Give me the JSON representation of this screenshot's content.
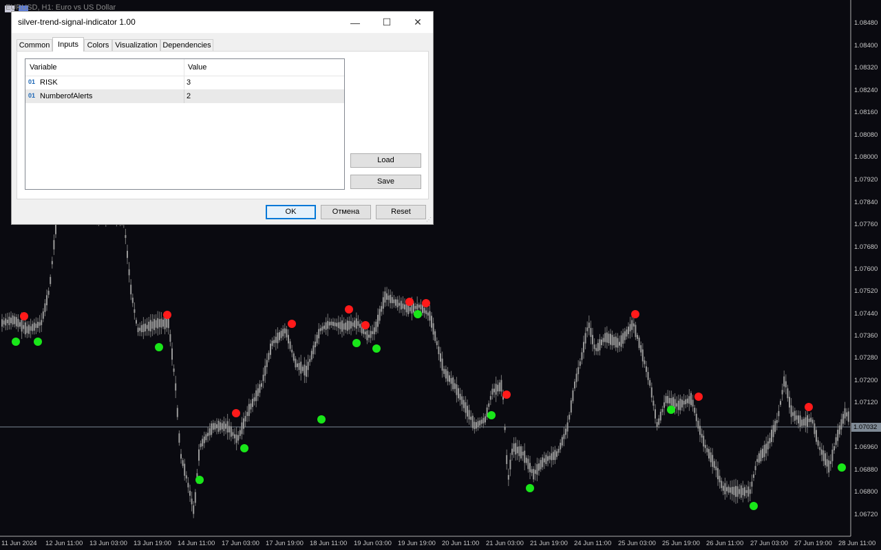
{
  "chart": {
    "title": "EURUSD, H1: Euro vs US Dollar",
    "current_price": "1.07032",
    "price_axis": [
      "1.08480",
      "1.08400",
      "1.08320",
      "1.08240",
      "1.08160",
      "1.08080",
      "1.08000",
      "1.07920",
      "1.07840",
      "1.07760",
      "1.07680",
      "1.07600",
      "1.07520",
      "1.07440",
      "1.07360",
      "1.07280",
      "1.07200",
      "1.07120",
      "1.06960",
      "1.06880",
      "1.06800",
      "1.06720"
    ],
    "time_axis": [
      "11 Jun 2024",
      "12 Jun 11:00",
      "13 Jun 03:00",
      "13 Jun 19:00",
      "14 Jun 11:00",
      "17 Jun 03:00",
      "17 Jun 19:00",
      "18 Jun 11:00",
      "19 Jun 03:00",
      "19 Jun 19:00",
      "20 Jun 11:00",
      "21 Jun 03:00",
      "21 Jun 19:00",
      "24 Jun 11:00",
      "25 Jun 03:00",
      "25 Jun 19:00",
      "26 Jun 11:00",
      "27 Jun 03:00",
      "27 Jun 19:00",
      "28 Jun 11:00"
    ],
    "colors": {
      "background": "#0a0a10",
      "candle": "#9a9a9a",
      "sell_signal": "#ff1a1a",
      "buy_signal": "#19e619",
      "price_line": "#7f8a96"
    }
  },
  "dialog": {
    "title": "silver-trend-signal-indicator 1.00",
    "window_buttons": {
      "minimize": "—",
      "maximize": "☐",
      "close": "✕"
    },
    "tabs": [
      "Common",
      "Inputs",
      "Colors",
      "Visualization",
      "Dependencies"
    ],
    "active_tab": "Inputs",
    "grid": {
      "headers": {
        "variable": "Variable",
        "value": "Value"
      },
      "rows": [
        {
          "icon": "01",
          "name": "RISK",
          "value": "3"
        },
        {
          "icon": "01",
          "name": "NumberofAlerts",
          "value": "2"
        }
      ]
    },
    "side_buttons": {
      "load": "Load",
      "save": "Save"
    },
    "footer_buttons": {
      "ok": "OK",
      "cancel": "Отмена",
      "reset": "Reset"
    }
  }
}
